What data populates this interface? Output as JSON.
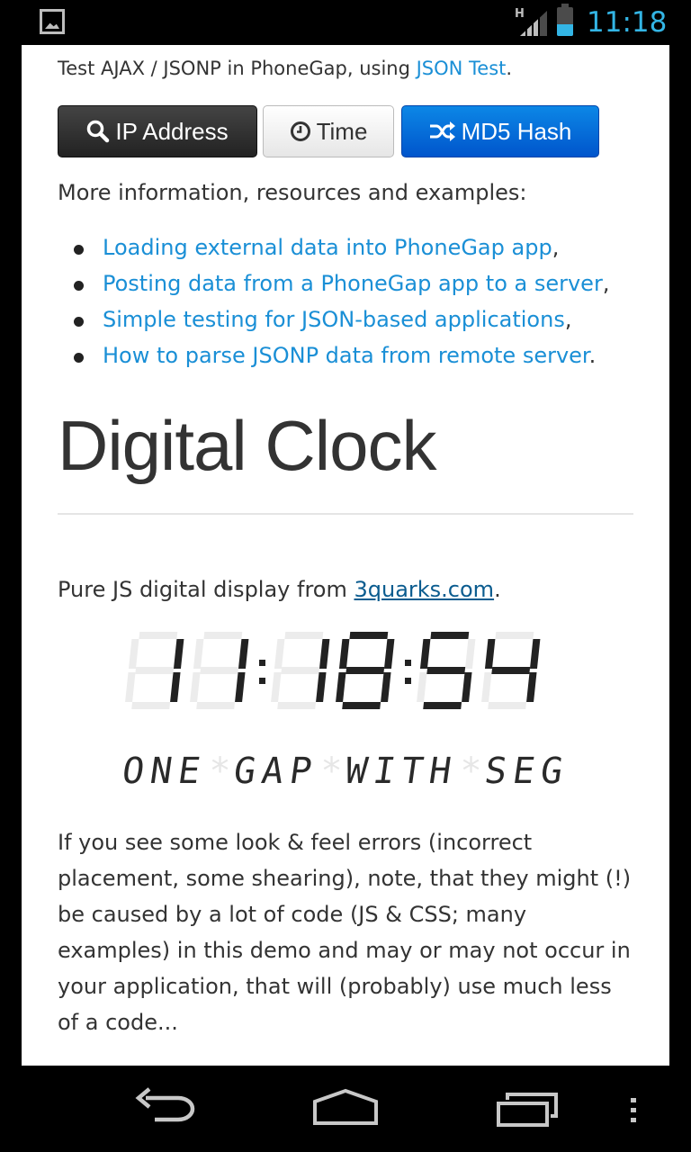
{
  "status_bar": {
    "network_type": "H",
    "time": "11:18",
    "accent_color": "#33b5e5",
    "icons": [
      "image-notification-icon",
      "signal-icon",
      "battery-icon"
    ]
  },
  "intro": {
    "text": "Test AJAX / JSONP in PhoneGap, using ",
    "link": "JSON Test",
    "suffix": "."
  },
  "buttons": {
    "ip": "IP Address",
    "time": "Time",
    "md5": "MD5 Hash"
  },
  "more_info": "More information, resources and examples:",
  "resources": [
    {
      "link": "Loading external data into PhoneGap app",
      "suffix": ","
    },
    {
      "link": "Posting data from a PhoneGap app to a server",
      "suffix": ","
    },
    {
      "link": "Simple testing for JSON-based applications",
      "suffix": ","
    },
    {
      "link": "How to parse JSONP data from remote server",
      "suffix": "."
    }
  ],
  "heading": "Digital Clock",
  "display_source": {
    "text": "Pure JS digital display from ",
    "link": "3quarks.com",
    "suffix": "."
  },
  "clock": {
    "time": "11:18:54",
    "segment_text": "ONE GAP WITH SEG"
  },
  "paragraph": "If you see some look & feel errors (incorrect placement, some shearing), note, that they might (!) be caused by a lot of code (JS & CSS; many examples) in this demo and may or may not occur in your application, that will (probably) use much less of a code...",
  "colors": {
    "link": "#1a8fd6",
    "primary_button": "#0c87e6",
    "dark_button": "#333333"
  },
  "nav_bar": [
    "back-icon",
    "home-icon",
    "recent-apps-icon",
    "menu-icon"
  ]
}
